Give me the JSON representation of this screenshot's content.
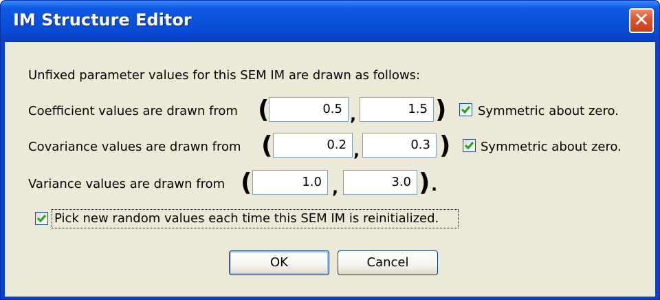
{
  "window": {
    "title": "IM Structure Editor",
    "close_icon": "close-icon"
  },
  "intro": "Unfixed parameter values for this SEM IM are drawn as follows:",
  "rows": [
    {
      "label": "Coefficient values are drawn from",
      "low": "0.5",
      "high": "1.5",
      "symmetric_label": "Symmetric about zero.",
      "symmetric_checked": true
    },
    {
      "label": "Covariance values are drawn from",
      "low": "0.2",
      "high": "0.3",
      "symmetric_label": "Symmetric about zero.",
      "symmetric_checked": true
    },
    {
      "label": "Variance values are drawn from",
      "low": "1.0",
      "high": "3.0"
    }
  ],
  "punct": {
    "open": "(",
    "close": ")",
    "comma": ",",
    "period": "."
  },
  "random_option": {
    "label": "Pick new random values each time this SEM IM is reinitialized.",
    "checked": true
  },
  "buttons": {
    "ok": "OK",
    "cancel": "Cancel"
  },
  "colors": {
    "titlebar": "#0a4fd8",
    "client": "#ece9d8",
    "check": "#21a121",
    "close": "#d9542c"
  }
}
